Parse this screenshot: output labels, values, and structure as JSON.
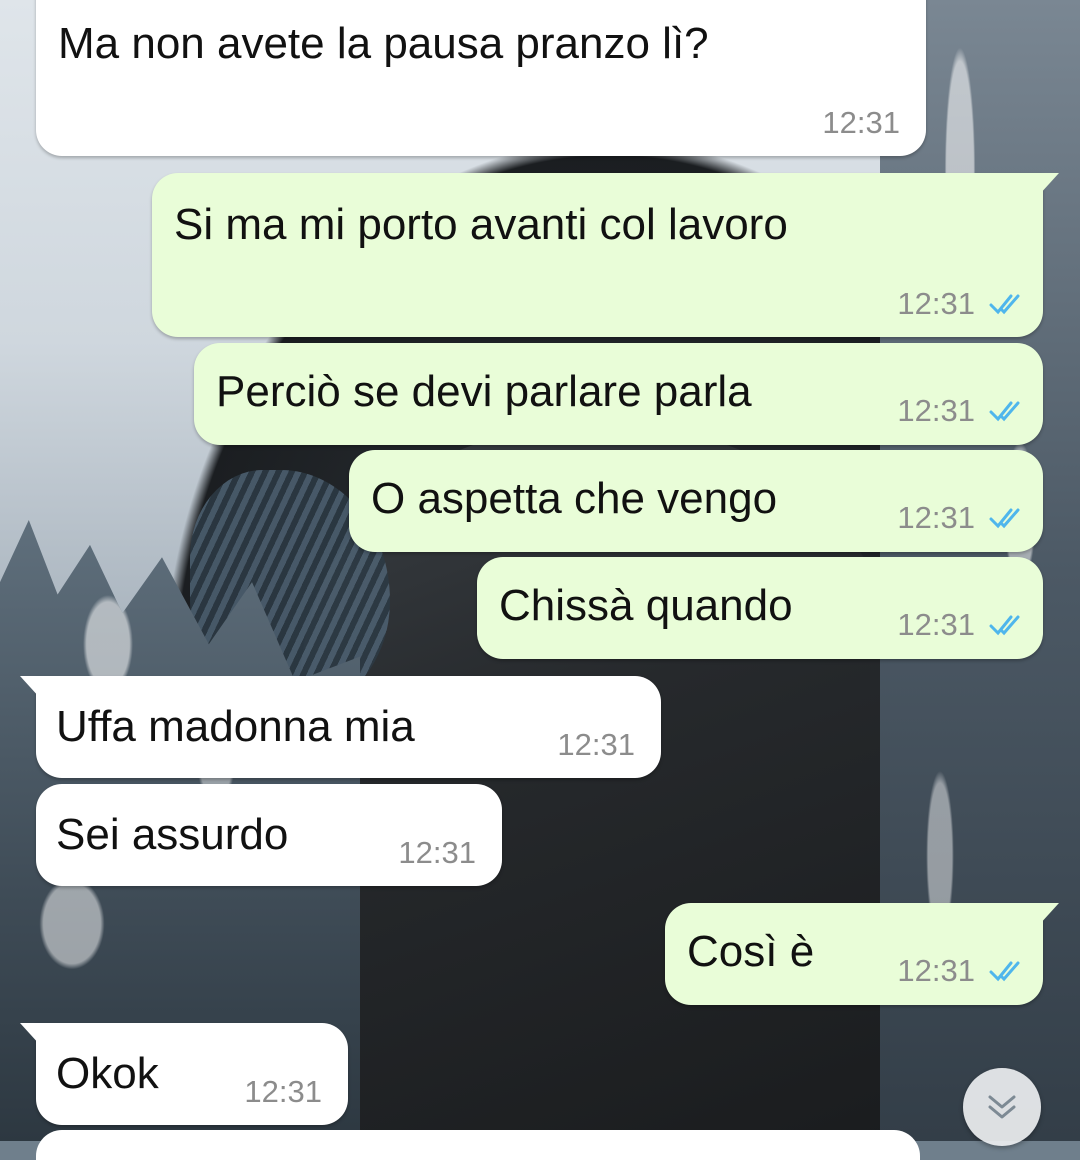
{
  "messages": [
    {
      "text": "Ma non avete la pausa pranzo lì?",
      "time": "12:31",
      "direction": "incoming"
    },
    {
      "text": "Si ma mi porto avanti col lavoro",
      "time": "12:31",
      "direction": "outgoing",
      "status": "read"
    },
    {
      "text": "Perciò se devi parlare parla",
      "time": "12:31",
      "direction": "outgoing",
      "status": "read"
    },
    {
      "text": "O aspetta che vengo",
      "time": "12:31",
      "direction": "outgoing",
      "status": "read"
    },
    {
      "text": "Chissà quando",
      "time": "12:31",
      "direction": "outgoing",
      "status": "read"
    },
    {
      "text": "Uffa madonna mia",
      "time": "12:31",
      "direction": "incoming"
    },
    {
      "text": "Sei assurdo",
      "time": "12:31",
      "direction": "incoming"
    },
    {
      "text": "Così è",
      "time": "12:31",
      "direction": "outgoing",
      "status": "read"
    },
    {
      "text": "Okok",
      "time": "12:31",
      "direction": "incoming"
    }
  ],
  "icons": {
    "read_receipt": "double-check-icon",
    "scroll_down": "chevron-double-down-icon"
  },
  "colors": {
    "incoming_bubble": "#ffffff",
    "outgoing_bubble": "#e9fdd8",
    "read_tick": "#4fb6ec",
    "timestamp": "#8c8c8c"
  }
}
